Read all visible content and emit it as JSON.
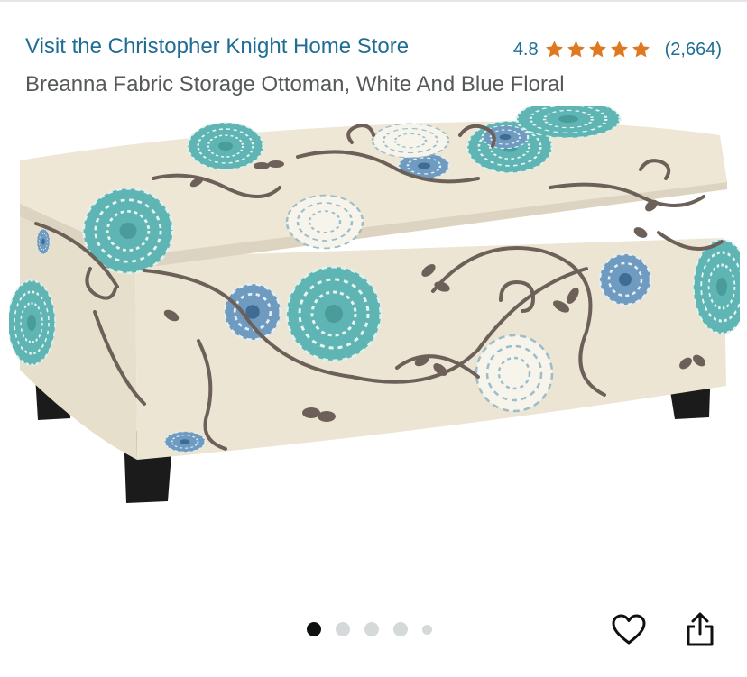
{
  "product": {
    "store_link": "Visit the Christopher Knight Home Store",
    "title": "Breanna Fabric Storage Ottoman, White And Blue Floral",
    "rating_value": "4.8",
    "rating_stars": 5,
    "review_count": "(2,664)"
  },
  "gallery": {
    "total_images": 5,
    "active_index": 0
  },
  "actions": {
    "like_icon": "heart-icon",
    "share_icon": "share-icon"
  },
  "colors": {
    "link": "#1f6d95",
    "star": "#de7921",
    "title": "#565959",
    "fabric": "#ece5d3",
    "teal_flower": "#5fb5b3",
    "blue_flower": "#4f7fa6",
    "vine": "#6d6058",
    "legs": "#1b1b1b"
  }
}
